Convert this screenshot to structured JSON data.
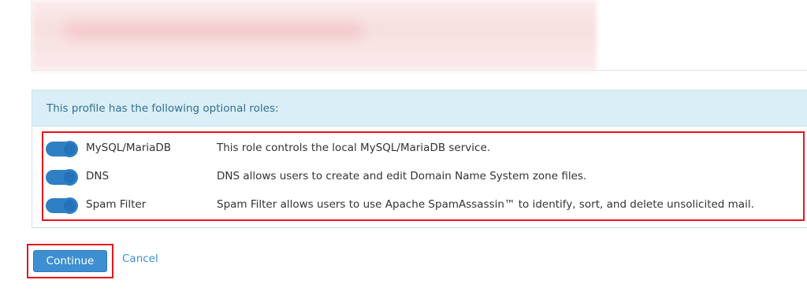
{
  "roles_panel": {
    "header": "This profile has the following optional roles:",
    "roles": [
      {
        "name": "MySQL/MariaDB",
        "description": "This role controls the local MySQL/MariaDB service.",
        "enabled": true
      },
      {
        "name": "DNS",
        "description": "DNS allows users to create and edit Domain Name System zone files.",
        "enabled": true
      },
      {
        "name": "Spam Filter",
        "description": "Spam Filter allows users to use Apache SpamAssassin™ to identify, sort, and delete unsolicited mail.",
        "enabled": true
      }
    ]
  },
  "actions": {
    "continue_label": "Continue",
    "cancel_label": "Cancel"
  },
  "colors": {
    "accent": "#2e7fc4",
    "header_bg": "#daeef7",
    "header_text": "#31708f",
    "highlight_outline": "#e8151b"
  }
}
